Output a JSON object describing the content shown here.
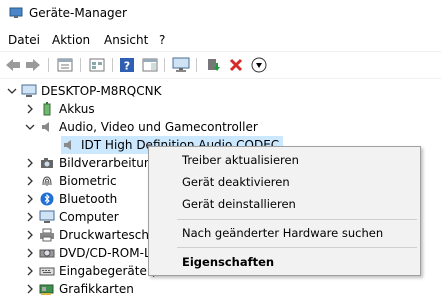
{
  "window": {
    "title": "Geräte-Manager"
  },
  "menu": {
    "items": [
      "Datei",
      "Aktion",
      "Ansicht",
      "?"
    ]
  },
  "toolbar": {
    "buttons": [
      "back-icon",
      "forward-icon",
      "properties-icon",
      "view-icon",
      "help-icon",
      "action-panel-icon",
      "scan-hardware-icon",
      "update-driver-icon",
      "uninstall-icon",
      "disable-icon"
    ]
  },
  "tree": {
    "root": "DESKTOP-M8RQCNK",
    "items": [
      {
        "label": "Akkus",
        "icon": "battery-icon",
        "expanded": false
      },
      {
        "label": "Audio, Video und Gamecontroller",
        "icon": "speaker-icon",
        "expanded": true
      },
      {
        "label": "IDT High Definition Audio CODEC",
        "icon": "speaker-icon",
        "child": true,
        "selected": true
      },
      {
        "label": "Bildverarbeitung",
        "icon": "camera-icon",
        "expanded": false
      },
      {
        "label": "Biometric",
        "icon": "fingerprint-icon",
        "expanded": false
      },
      {
        "label": "Bluetooth",
        "icon": "bluetooth-icon",
        "expanded": false
      },
      {
        "label": "Computer",
        "icon": "monitor-icon",
        "expanded": false
      },
      {
        "label": "Druckwarteschla",
        "icon": "printer-icon",
        "expanded": false
      },
      {
        "label": "DVD/CD-ROM-L",
        "icon": "disc-drive-icon",
        "expanded": false
      },
      {
        "label": "Eingabegeräte (I",
        "icon": "keyboard-icon",
        "expanded": false
      },
      {
        "label": "Grafikkarten",
        "icon": "display-adapter-icon",
        "expanded": false
      }
    ]
  },
  "context_menu": {
    "items": [
      "Treiber aktualisieren",
      "Gerät deaktivieren",
      "Gerät deinstallieren",
      "Nach geänderter Hardware suchen",
      "Eigenschaften"
    ]
  },
  "colors": {
    "selection": "#cce8ff",
    "accent": "#0063b1",
    "error": "#d42a2a",
    "ok": "#1f9c3a"
  }
}
